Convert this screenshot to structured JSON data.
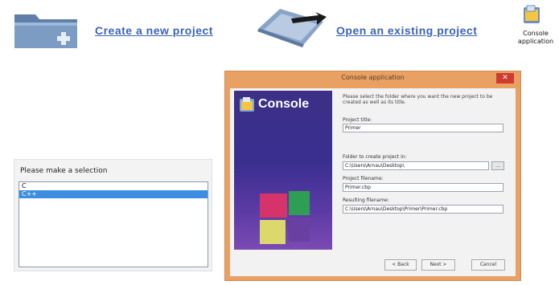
{
  "topbar": {
    "create_label": "Create a new project",
    "open_label": "Open an existing project",
    "console_label_line1": "Console",
    "console_label_line2": "application"
  },
  "selection": {
    "title": "Please make a selection",
    "items": [
      "C",
      "C++"
    ],
    "selected_index": 1
  },
  "dialog": {
    "title": "Console application",
    "close": "✕",
    "banner_title": "Console",
    "instructions": "Please select the folder where you want the new project to be created as well as its title.",
    "project_title_label": "Project title:",
    "project_title_value": "Primer",
    "folder_label": "Folder to create project in:",
    "folder_value": "C:\\Users\\Arnau\\Desktop\\",
    "browse_label": "...",
    "filename_label": "Project filename:",
    "filename_value": "Primer.cbp",
    "result_label": "Resulting filename:",
    "result_value": "C:\\Users\\Arnau\\Desktop\\Primer\\Primer.cbp",
    "back_label": "< Back",
    "next_label": "Next >",
    "cancel_label": "Cancel"
  },
  "colors": {
    "link": "#3c63b8",
    "dialog_frame": "#e9a163",
    "close_button": "#cf3b2e",
    "banner": "#3b2f86",
    "selection_highlight": "#3d8ee0"
  },
  "icons": {
    "create": "folder-add-icon",
    "open": "open-folder-arrow-icon",
    "console": "console-app-icon"
  }
}
